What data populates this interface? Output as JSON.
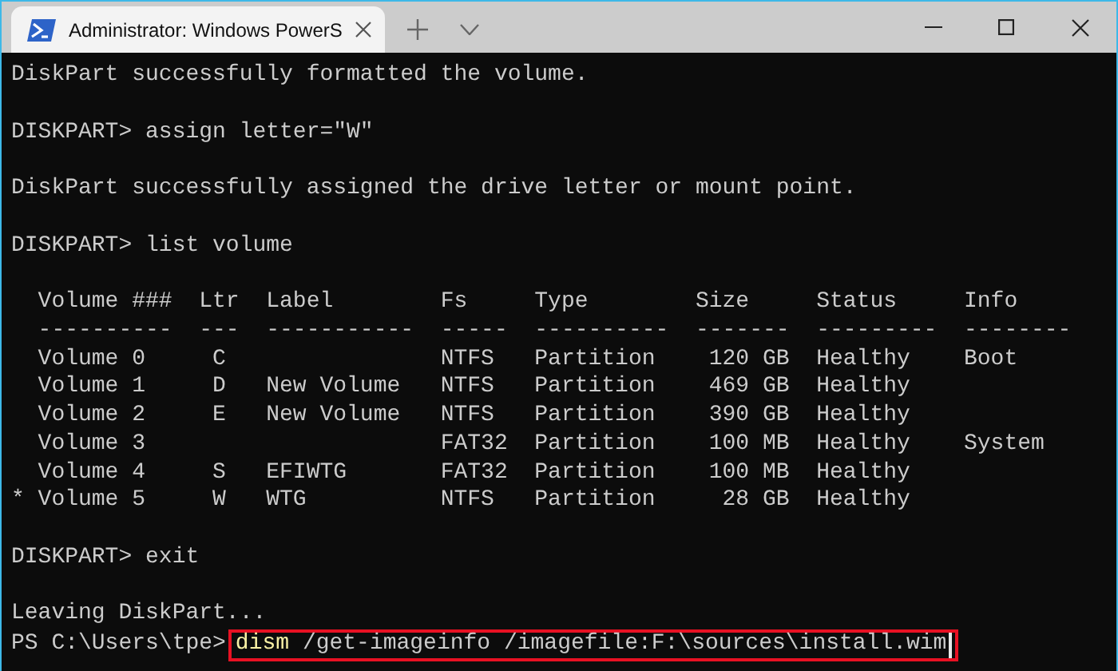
{
  "window": {
    "tabs": [
      {
        "title": "Administrator: Windows PowerS",
        "selected": true
      }
    ]
  },
  "terminal": {
    "blocks": [
      [
        "DiskPart successfully formatted the volume."
      ],
      [
        "DISKPART> assign letter=\"W\""
      ],
      [
        "DiskPart successfully assigned the drive letter or mount point."
      ],
      [
        "DISKPART> list volume"
      ],
      [
        "  Volume ###  Ltr  Label        Fs     Type        Size     Status     Info",
        "  ----------  ---  -----------  -----  ----------  -------  ---------  --------",
        "  Volume 0     C                NTFS   Partition    120 GB  Healthy    Boot",
        "  Volume 1     D   New Volume   NTFS   Partition    469 GB  Healthy",
        "  Volume 2     E   New Volume   NTFS   Partition    390 GB  Healthy",
        "  Volume 3                      FAT32  Partition    100 MB  Healthy    System",
        "  Volume 4     S   EFIWTG       FAT32  Partition    100 MB  Healthy",
        "* Volume 5     W   WTG          NTFS   Partition     28 GB  Healthy"
      ],
      [
        "DISKPART> exit"
      ],
      [
        "Leaving DiskPart..."
      ]
    ],
    "prompt": {
      "text": "PS C:\\Users\\tpe>",
      "command": "dism",
      "args": "/get-imageinfo /imagefile:F:\\sources\\install.wim",
      "highlighted": true
    }
  }
}
